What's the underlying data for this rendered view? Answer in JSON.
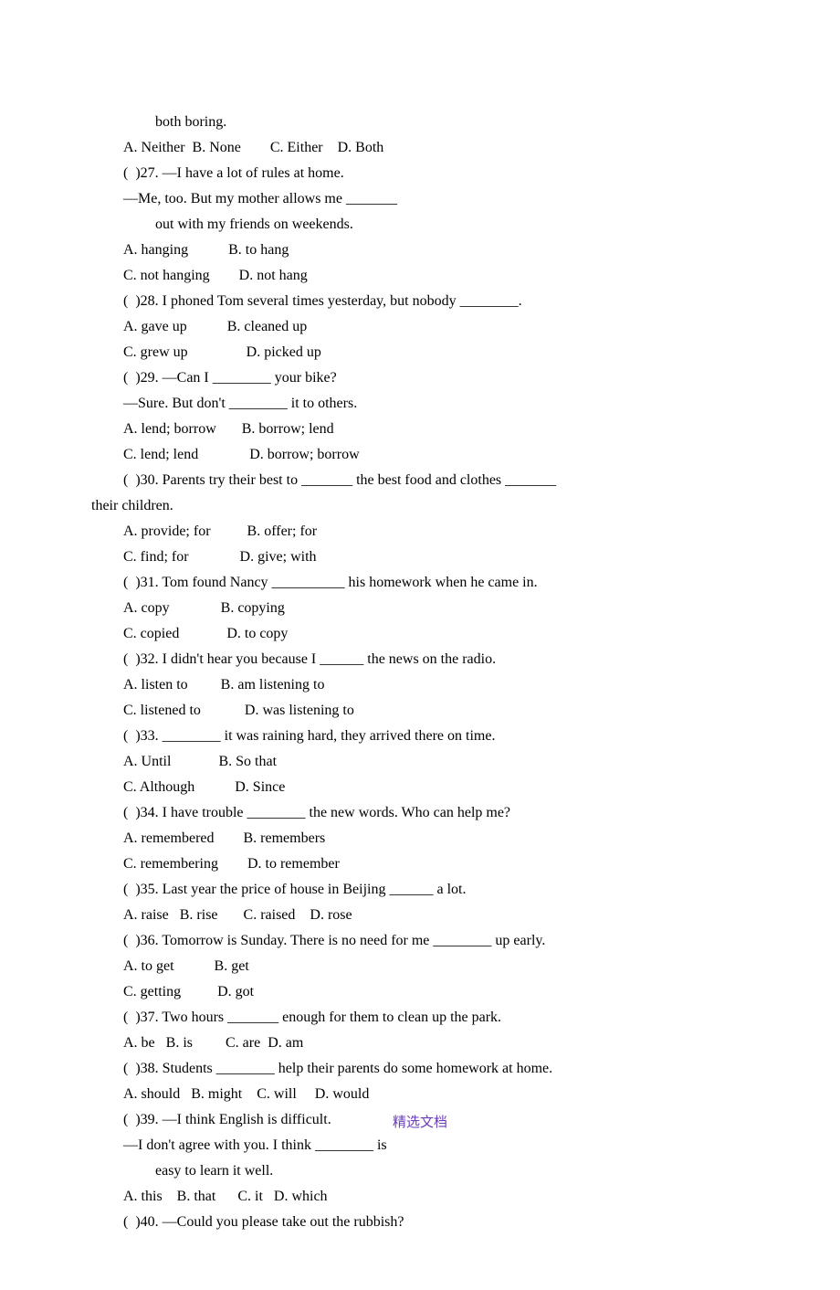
{
  "lines": [
    {
      "cls": "indent2",
      "text": "both boring."
    },
    {
      "cls": "indent1",
      "text": "A. Neither  B. None        C. Either    D. Both"
    },
    {
      "cls": "indent1",
      "text": "(  )27. —I have a lot of rules at home."
    },
    {
      "cls": "indent1",
      "text": "—Me, too. But my mother allows me _______"
    },
    {
      "cls": "indent2",
      "text": "out with my friends on weekends."
    },
    {
      "cls": "indent1",
      "text": "A. hanging           B. to hang"
    },
    {
      "cls": "indent1",
      "text": "C. not hanging        D. not hang"
    },
    {
      "cls": "indent1",
      "text": "(  )28. I phoned Tom several times yesterday, but nobody ________."
    },
    {
      "cls": "indent1",
      "text": "A. gave up           B. cleaned up"
    },
    {
      "cls": "indent1",
      "text": "C. grew up                D. picked up"
    },
    {
      "cls": "indent1",
      "text": "(  )29. —Can I ________ your bike?"
    },
    {
      "cls": "indent1",
      "text": "—Sure. But don't ________ it to others."
    },
    {
      "cls": "indent1",
      "text": "A. lend; borrow       B. borrow; lend"
    },
    {
      "cls": "indent1",
      "text": "C. lend; lend              D. borrow; borrow"
    },
    {
      "cls": "indent1",
      "text": "(  )30. Parents try their best to _______ the best food and clothes _______"
    },
    {
      "cls": "",
      "text": "their children."
    },
    {
      "cls": "indent1",
      "text": "A. provide; for          B. offer; for"
    },
    {
      "cls": "indent1",
      "text": "C. find; for              D. give; with"
    },
    {
      "cls": "indent1",
      "text": "(  )31. Tom found Nancy __________ his homework when he came in."
    },
    {
      "cls": "indent1",
      "text": "A. copy              B. copying"
    },
    {
      "cls": "indent1",
      "text": "C. copied             D. to copy"
    },
    {
      "cls": "indent1",
      "text": "(  )32. I didn't hear you because I ______ the news on the radio."
    },
    {
      "cls": "indent1",
      "text": "A. listen to         B. am listening to"
    },
    {
      "cls": "indent1",
      "text": "C. listened to            D. was listening to"
    },
    {
      "cls": "indent1",
      "text": "(  )33. ________ it was raining hard, they arrived there on time."
    },
    {
      "cls": "indent1",
      "text": "A. Until             B. So that"
    },
    {
      "cls": "indent1",
      "text": "C. Although           D. Since"
    },
    {
      "cls": "indent1",
      "text": "(  )34. I have trouble ________ the new words. Who can help me?"
    },
    {
      "cls": "indent1",
      "text": "A. remembered        B. remembers"
    },
    {
      "cls": "indent1",
      "text": "C. remembering        D. to remember"
    },
    {
      "cls": "indent1",
      "text": "(  )35. Last year the price of house in Beijing ______ a lot."
    },
    {
      "cls": "indent1",
      "text": "A. raise   B. rise       C. raised    D. rose"
    },
    {
      "cls": "indent1",
      "text": "(  )36. Tomorrow is Sunday. There is no need for me ________ up early."
    },
    {
      "cls": "indent1",
      "text": "A. to get           B. get"
    },
    {
      "cls": "indent1",
      "text": "C. getting          D. got"
    },
    {
      "cls": "indent1",
      "text": "(  )37. Two hours _______ enough for them to clean up the park."
    },
    {
      "cls": "indent1",
      "text": "A. be   B. is         C. are  D. am"
    },
    {
      "cls": "indent1",
      "text": "(  )38. Students ________ help their parents do some homework at home."
    },
    {
      "cls": "indent1",
      "text": "A. should   B. might    C. will     D. would"
    },
    {
      "cls": "indent1",
      "text": "(  )39. —I think English is difficult."
    },
    {
      "cls": "indent1",
      "text": "—I don't agree with you. I think ________ is"
    },
    {
      "cls": "indent2",
      "text": "easy to learn it well."
    },
    {
      "cls": "indent1",
      "text": "A. this    B. that      C. it   D. which"
    },
    {
      "cls": "indent1",
      "text": "(  )40. —Could you please take out the rubbish?"
    }
  ],
  "footer": "精选文档"
}
